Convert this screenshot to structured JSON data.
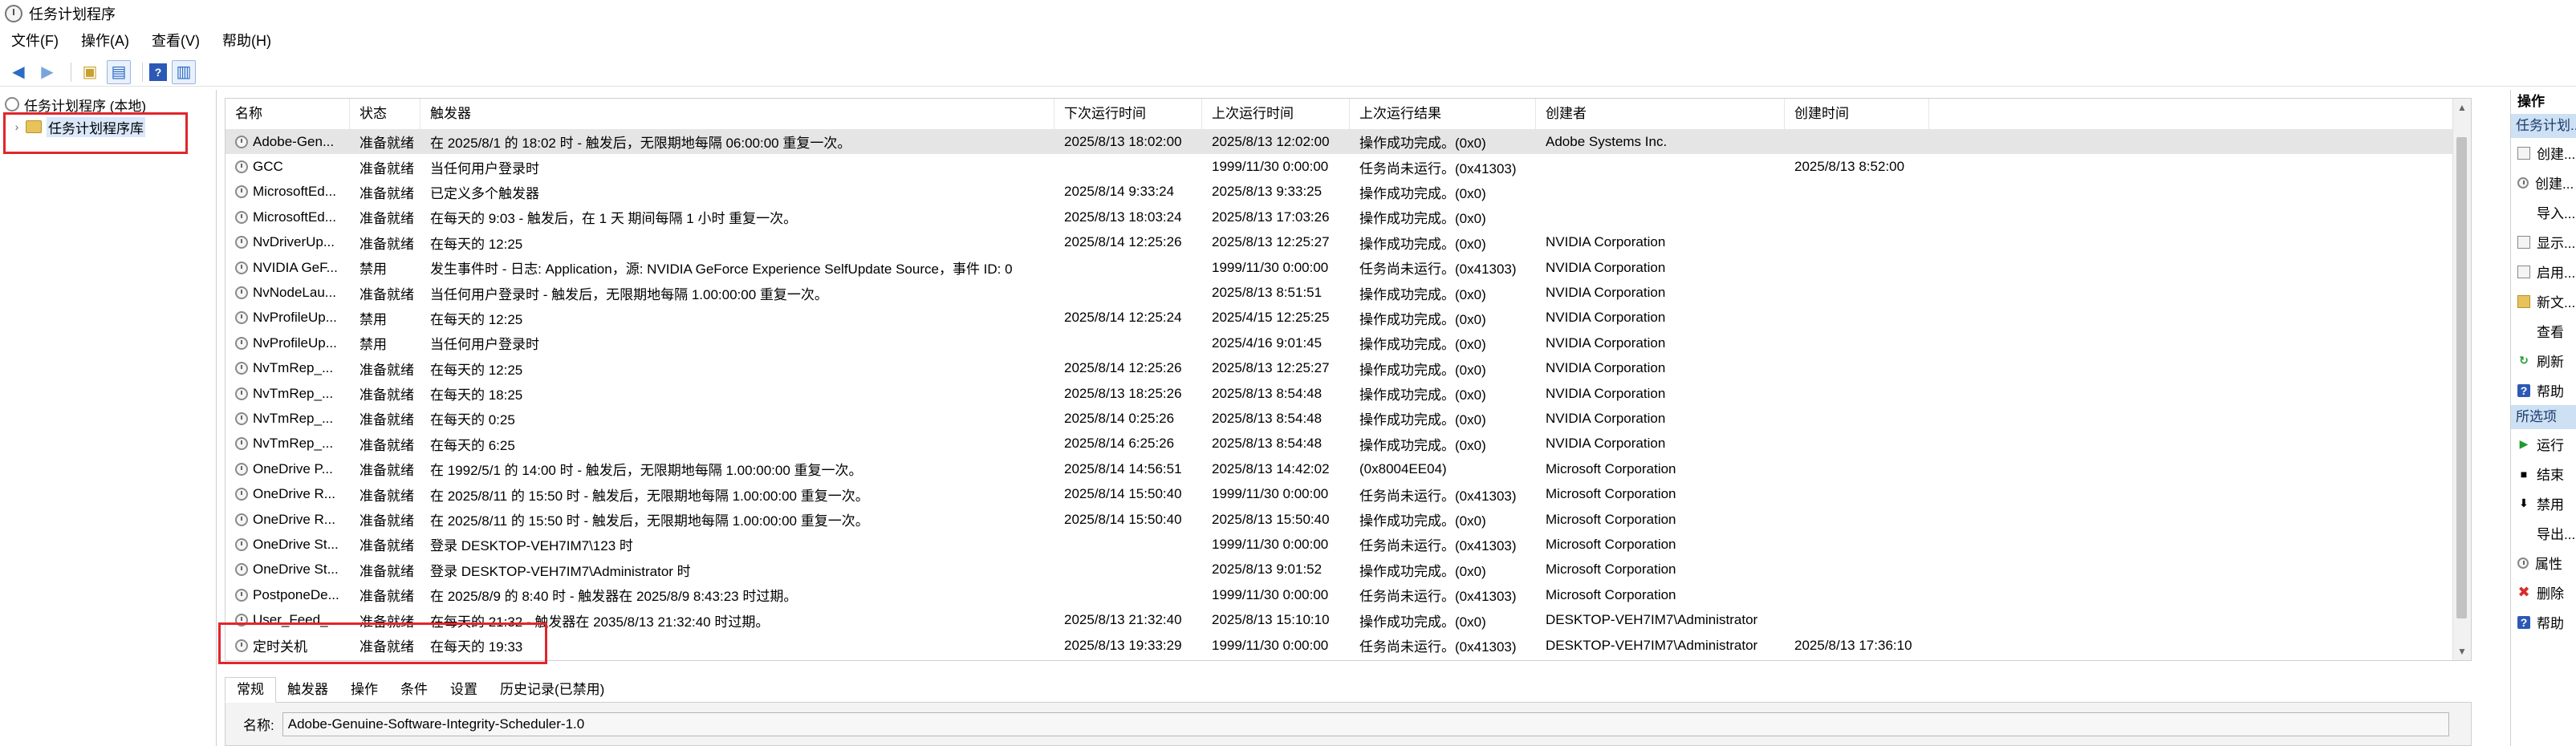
{
  "window": {
    "title": "任务计划程序"
  },
  "menu": [
    "文件(F)",
    "操作(A)",
    "查看(V)",
    "帮助(H)"
  ],
  "tree": {
    "root": "任务计划程序 (本地)",
    "library": "任务计划程序库"
  },
  "columns": [
    "名称",
    "状态",
    "触发器",
    "下次运行时间",
    "上次运行时间",
    "上次运行结果",
    "创建者",
    "创建时间"
  ],
  "tasks": [
    {
      "name": "Adobe-Gen...",
      "status": "准备就绪",
      "trigger": "在 2025/8/1 的 18:02 时 - 触发后，无限期地每隔 06:00:00 重复一次。",
      "next": "2025/8/13 18:02:00",
      "last": "2025/8/13 12:02:00",
      "result": "操作成功完成。(0x0)",
      "author": "Adobe Systems Inc.",
      "created": ""
    },
    {
      "name": "GCC",
      "status": "准备就绪",
      "trigger": "当任何用户登录时",
      "next": "",
      "last": "1999/11/30 0:00:00",
      "result": "任务尚未运行。(0x41303)",
      "author": "",
      "created": "2025/8/13 8:52:00"
    },
    {
      "name": "MicrosoftEd...",
      "status": "准备就绪",
      "trigger": "已定义多个触发器",
      "next": "2025/8/14 9:33:24",
      "last": "2025/8/13 9:33:25",
      "result": "操作成功完成。(0x0)",
      "author": "",
      "created": ""
    },
    {
      "name": "MicrosoftEd...",
      "status": "准备就绪",
      "trigger": "在每天的 9:03 - 触发后，在 1 天 期间每隔 1 小时 重复一次。",
      "next": "2025/8/13 18:03:24",
      "last": "2025/8/13 17:03:26",
      "result": "操作成功完成。(0x0)",
      "author": "",
      "created": ""
    },
    {
      "name": "NvDriverUp...",
      "status": "准备就绪",
      "trigger": "在每天的 12:25",
      "next": "2025/8/14 12:25:26",
      "last": "2025/8/13 12:25:27",
      "result": "操作成功完成。(0x0)",
      "author": "NVIDIA Corporation",
      "created": ""
    },
    {
      "name": "NVIDIA GeF...",
      "status": "禁用",
      "trigger": "发生事件时 - 日志: Application，源: NVIDIA GeForce Experience SelfUpdate Source，事件 ID: 0",
      "next": "",
      "last": "1999/11/30 0:00:00",
      "result": "任务尚未运行。(0x41303)",
      "author": "NVIDIA Corporation",
      "created": ""
    },
    {
      "name": "NvNodeLau...",
      "status": "准备就绪",
      "trigger": "当任何用户登录时 - 触发后，无限期地每隔 1.00:00:00 重复一次。",
      "next": "",
      "last": "2025/8/13 8:51:51",
      "result": "操作成功完成。(0x0)",
      "author": "NVIDIA Corporation",
      "created": ""
    },
    {
      "name": "NvProfileUp...",
      "status": "禁用",
      "trigger": "在每天的 12:25",
      "next": "2025/8/14 12:25:24",
      "last": "2025/4/15 12:25:25",
      "result": "操作成功完成。(0x0)",
      "author": "NVIDIA Corporation",
      "created": ""
    },
    {
      "name": "NvProfileUp...",
      "status": "禁用",
      "trigger": "当任何用户登录时",
      "next": "",
      "last": "2025/4/16 9:01:45",
      "result": "操作成功完成。(0x0)",
      "author": "NVIDIA Corporation",
      "created": ""
    },
    {
      "name": "NvTmRep_...",
      "status": "准备就绪",
      "trigger": "在每天的 12:25",
      "next": "2025/8/14 12:25:26",
      "last": "2025/8/13 12:25:27",
      "result": "操作成功完成。(0x0)",
      "author": "NVIDIA Corporation",
      "created": ""
    },
    {
      "name": "NvTmRep_...",
      "status": "准备就绪",
      "trigger": "在每天的 18:25",
      "next": "2025/8/13 18:25:26",
      "last": "2025/8/13 8:54:48",
      "result": "操作成功完成。(0x0)",
      "author": "NVIDIA Corporation",
      "created": ""
    },
    {
      "name": "NvTmRep_...",
      "status": "准备就绪",
      "trigger": "在每天的 0:25",
      "next": "2025/8/14 0:25:26",
      "last": "2025/8/13 8:54:48",
      "result": "操作成功完成。(0x0)",
      "author": "NVIDIA Corporation",
      "created": ""
    },
    {
      "name": "NvTmRep_...",
      "status": "准备就绪",
      "trigger": "在每天的 6:25",
      "next": "2025/8/14 6:25:26",
      "last": "2025/8/13 8:54:48",
      "result": "操作成功完成。(0x0)",
      "author": "NVIDIA Corporation",
      "created": ""
    },
    {
      "name": "OneDrive P...",
      "status": "准备就绪",
      "trigger": "在 1992/5/1 的 14:00 时 - 触发后，无限期地每隔 1.00:00:00 重复一次。",
      "next": "2025/8/14 14:56:51",
      "last": "2025/8/13 14:42:02",
      "result": "(0x8004EE04)",
      "author": "Microsoft Corporation",
      "created": ""
    },
    {
      "name": "OneDrive R...",
      "status": "准备就绪",
      "trigger": "在 2025/8/11 的 15:50 时 - 触发后，无限期地每隔 1.00:00:00 重复一次。",
      "next": "2025/8/14 15:50:40",
      "last": "1999/11/30 0:00:00",
      "result": "任务尚未运行。(0x41303)",
      "author": "Microsoft Corporation",
      "created": ""
    },
    {
      "name": "OneDrive R...",
      "status": "准备就绪",
      "trigger": "在 2025/8/11 的 15:50 时 - 触发后，无限期地每隔 1.00:00:00 重复一次。",
      "next": "2025/8/14 15:50:40",
      "last": "2025/8/13 15:50:40",
      "result": "操作成功完成。(0x0)",
      "author": "Microsoft Corporation",
      "created": ""
    },
    {
      "name": "OneDrive St...",
      "status": "准备就绪",
      "trigger": "登录 DESKTOP-VEH7IM7\\123 时",
      "next": "",
      "last": "1999/11/30 0:00:00",
      "result": "任务尚未运行。(0x41303)",
      "author": "Microsoft Corporation",
      "created": ""
    },
    {
      "name": "OneDrive St...",
      "status": "准备就绪",
      "trigger": "登录 DESKTOP-VEH7IM7\\Administrator 时",
      "next": "",
      "last": "2025/8/13 9:01:52",
      "result": "操作成功完成。(0x0)",
      "author": "Microsoft Corporation",
      "created": ""
    },
    {
      "name": "PostponeDe...",
      "status": "准备就绪",
      "trigger": "在 2025/8/9 的 8:40 时 - 触发器在 2025/8/9 8:43:23 时过期。",
      "next": "",
      "last": "1999/11/30 0:00:00",
      "result": "任务尚未运行。(0x41303)",
      "author": "Microsoft Corporation",
      "created": ""
    },
    {
      "name": "User_Feed_...",
      "status": "准备就绪",
      "trigger": "在每天的 21:32 - 触发器在 2035/8/13 21:32:40 时过期。",
      "next": "2025/8/13 21:32:40",
      "last": "2025/8/13 15:10:10",
      "result": "操作成功完成。(0x0)",
      "author": "DESKTOP-VEH7IM7\\Administrator",
      "created": ""
    },
    {
      "name": "定时关机",
      "status": "准备就绪",
      "trigger": "在每天的 19:33",
      "next": "2025/8/13 19:33:29",
      "last": "1999/11/30 0:00:00",
      "result": "任务尚未运行。(0x41303)",
      "author": "DESKTOP-VEH7IM7\\Administrator",
      "created": "2025/8/13 17:36:10"
    }
  ],
  "tabs": [
    "常规",
    "触发器",
    "操作",
    "条件",
    "设置",
    "历史记录(已禁用)"
  ],
  "detail": {
    "label": "名称:",
    "value": "Adobe-Genuine-Software-Integrity-Scheduler-1.0"
  },
  "actions": {
    "header": "操作",
    "section1": "任务计划...",
    "items1": [
      "创建...",
      "创建...",
      "导入...",
      "显示...",
      "启用...",
      "新文...",
      "查看",
      "刷新",
      "帮助"
    ],
    "section2": "所选项",
    "items2": [
      "运行",
      "结束",
      "禁用",
      "导出...",
      "属性",
      "删除",
      "帮助"
    ]
  },
  "colors": {
    "highlight_box": "#e0262b",
    "selected_row": "#e5e5e5",
    "action_section": "#cde0f4"
  }
}
